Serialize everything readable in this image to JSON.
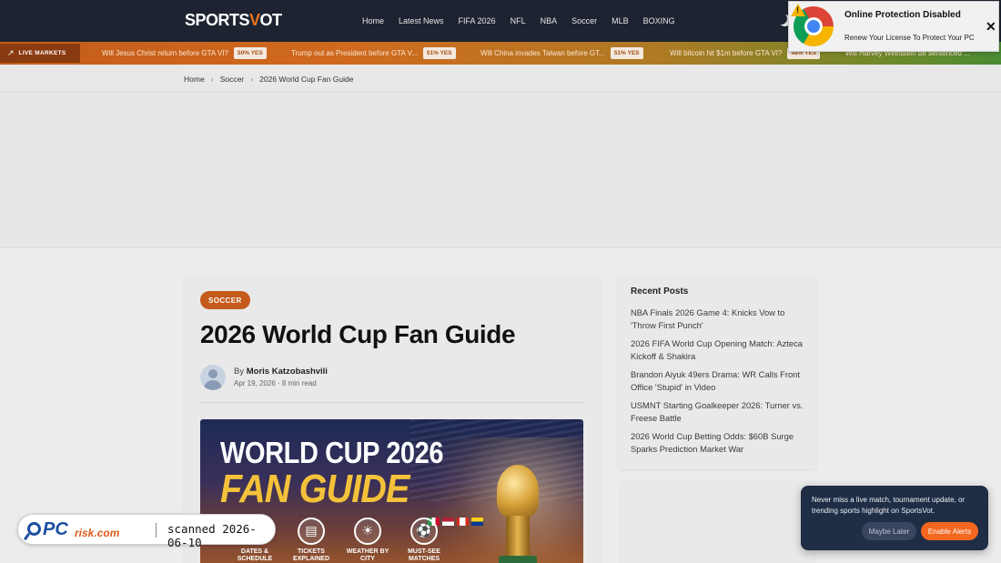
{
  "header": {
    "logo_main": "SPORTS",
    "logo_accent": "V",
    "logo_tail": "OT",
    "nav": [
      "Home",
      "Latest News",
      "FIFA 2026",
      "NFL",
      "NBA",
      "Soccer",
      "MLB",
      "BOXING"
    ]
  },
  "ticker": {
    "badge": "LIVE MARKETS",
    "items": [
      {
        "question": "Will Jesus Christ return before GTA VI?",
        "odds": "50% YES"
      },
      {
        "question": "Trump out as President before GTA V...",
        "odds": "51% YES"
      },
      {
        "question": "Will China invades Taiwan before GT...",
        "odds": "51% YES"
      },
      {
        "question": "Will bitcoin hit $1m before GTA VI?",
        "odds": "48% YES"
      },
      {
        "question": "Will Harvey Weinstein be sentenced ...",
        "odds": ""
      }
    ]
  },
  "breadcrumb": [
    "Home",
    "Soccer",
    "2026 World Cup Fan Guide"
  ],
  "article": {
    "category": "SOCCER",
    "title": "2026 World Cup Fan Guide",
    "by_prefix": "By",
    "author": "Moris Katzobashvili",
    "meta": "Apr 19, 2026 · 8 min read",
    "hero": {
      "line1": "WORLD CUP 2026",
      "line2": "FAN GUIDE",
      "icons": [
        {
          "icon": "calendar-icon",
          "label": "DATES & SCHEDULE"
        },
        {
          "icon": "ticket-icon",
          "label": "TICKETS EXPLAINED"
        },
        {
          "icon": "weather-icon",
          "label": "WEATHER BY CITY"
        },
        {
          "icon": "ball-icon",
          "label": "MUST-SEE MATCHES"
        }
      ]
    }
  },
  "sidebar": {
    "recent_title": "Recent Posts",
    "recent": [
      "NBA Finals 2026 Game 4: Knicks Vow to 'Throw First Punch'",
      "2026 FIFA World Cup Opening Match: Azteca Kickoff & Shakira",
      "Brandon Aiyuk 49ers Drama: WR Calls Front Office 'Stupid' in Video",
      "USMNT Starting Goalkeeper 2026: Turner vs. Freese Battle",
      "2026 World Cup Betting Odds: $60B Surge Sparks Prediction Market War"
    ]
  },
  "notification": {
    "title": "Online Protection Disabled",
    "body": "Renew Your License To Protect Your PC",
    "close": "✕"
  },
  "alert_popup": {
    "text": "Never miss a live match, tournament update, or trending sports highlight on SportsVot.",
    "later": "Maybe Later",
    "enable": "Enable Alerts"
  },
  "watermark": {
    "brand_pc": "PC",
    "brand_risk": "risk.com",
    "scan": "scanned 2026-06-10"
  }
}
